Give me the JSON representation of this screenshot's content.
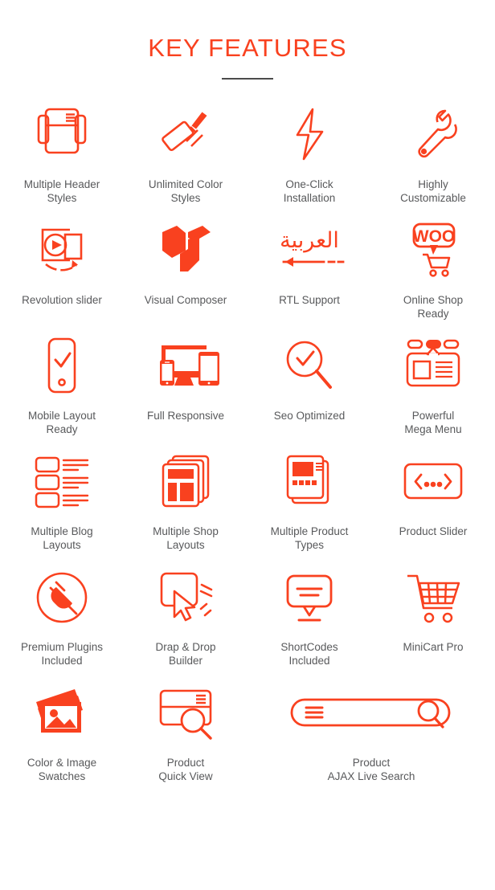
{
  "header": {
    "title": "KEY FEATURES",
    "divider": true
  },
  "accent_colors": {
    "primary": "#f9411f",
    "label": "#58595b",
    "divider": "#4c4c4c",
    "background": "#ffffff"
  },
  "features": [
    {
      "icon": "multiple-header-styles-icon",
      "label": "Multiple Header\nStyles"
    },
    {
      "icon": "paint-roller-icon",
      "label": "Unlimited Color\nStyles"
    },
    {
      "icon": "lightning-bolt-icon",
      "label": "One-Click\nInstallation"
    },
    {
      "icon": "wrench-icon",
      "label": "Highly\nCustomizable"
    },
    {
      "icon": "revolution-slider-icon",
      "label": "Revolution slider"
    },
    {
      "icon": "visual-composer-icon",
      "label": "Visual Composer"
    },
    {
      "icon": "rtl-support-icon",
      "label": "RTL Support"
    },
    {
      "icon": "woocommerce-icon",
      "label": "Online Shop\nReady"
    },
    {
      "icon": "mobile-check-icon",
      "label": "Mobile Layout\nReady"
    },
    {
      "icon": "responsive-devices-icon",
      "label": "Full Responsive"
    },
    {
      "icon": "seo-magnifier-icon",
      "label": "Seo Optimized"
    },
    {
      "icon": "mega-menu-icon",
      "label": "Powerful\nMega Menu"
    },
    {
      "icon": "blog-layouts-icon",
      "label": "Multiple Blog\nLayouts"
    },
    {
      "icon": "shop-layouts-icon",
      "label": "Multiple Shop\nLayouts"
    },
    {
      "icon": "product-types-icon",
      "label": "Multiple Product\nTypes"
    },
    {
      "icon": "product-slider-icon",
      "label": "Product Slider"
    },
    {
      "icon": "plugin-plug-icon",
      "label": "Premium Plugins\nIncluded"
    },
    {
      "icon": "drag-drop-cursor-icon",
      "label": "Drap & Drop\nBuilder"
    },
    {
      "icon": "shortcodes-bubble-icon",
      "label": "ShortCodes\nIncluded"
    },
    {
      "icon": "minicart-icon",
      "label": "MiniCart Pro"
    },
    {
      "icon": "image-swatches-icon",
      "label": "Color & Image\nSwatches"
    },
    {
      "icon": "quick-view-icon",
      "label": "Product\nQuick View"
    },
    {
      "icon": "ajax-search-icon",
      "label": "Product\nAJAX Live Search"
    }
  ]
}
